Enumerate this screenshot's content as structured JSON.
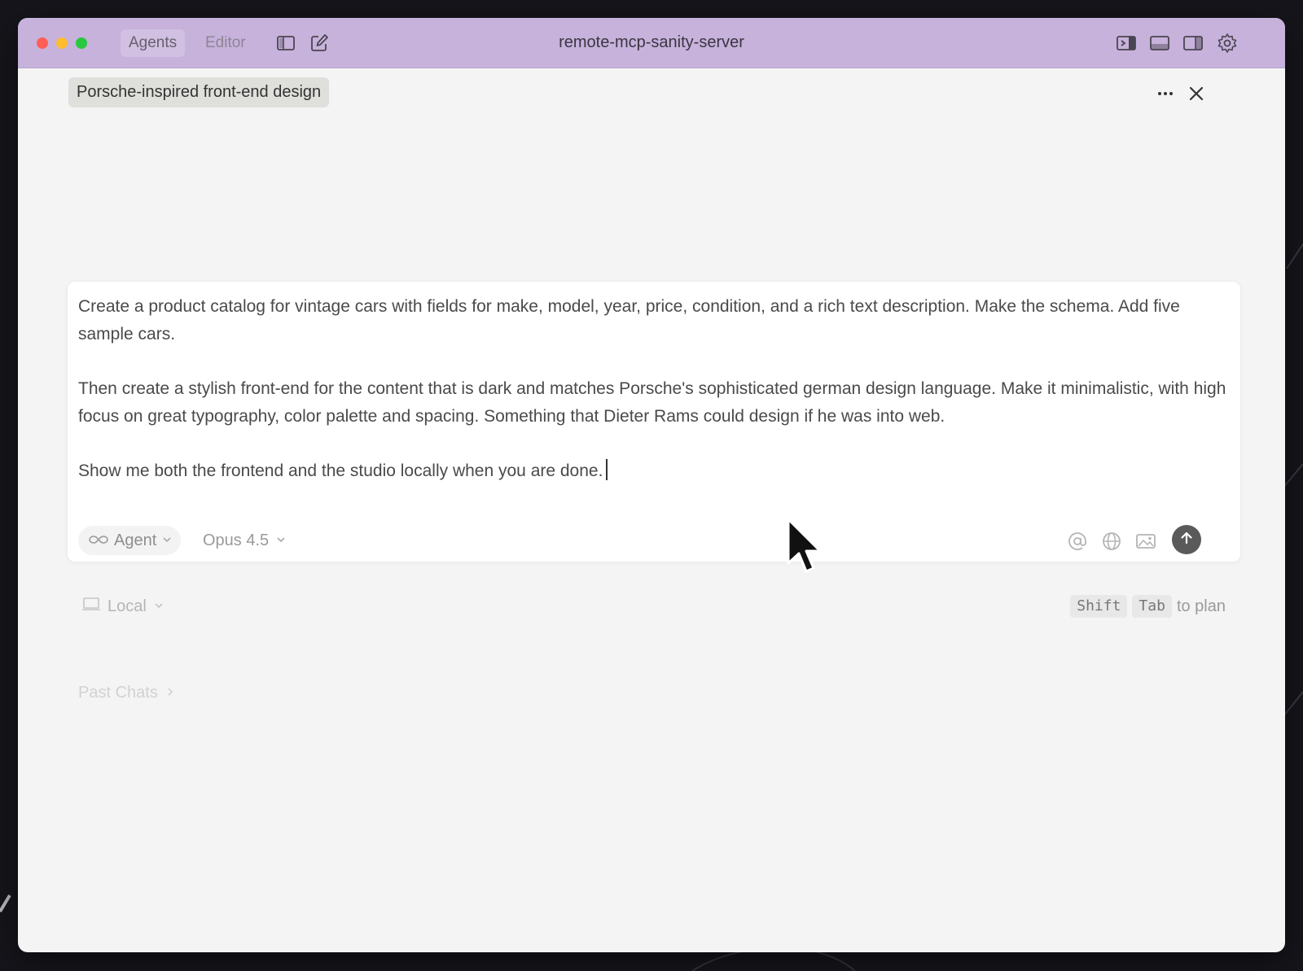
{
  "titlebar": {
    "tabs": [
      {
        "label": "Agents",
        "active": true
      },
      {
        "label": "Editor",
        "active": false
      }
    ],
    "title": "remote-mcp-sanity-server",
    "left_icons": [
      "sidebar-toggle-icon",
      "new-chat-icon"
    ],
    "right_icons": [
      "panel-left-icon",
      "panel-bottom-icon",
      "panel-right-icon",
      "gear-icon"
    ]
  },
  "chat": {
    "title": "Porsche-inspired front-end design",
    "menu_icon": "more-icon",
    "close_icon": "close-icon"
  },
  "composer": {
    "paragraphs": [
      "Create a product catalog for vintage cars with fields for make, model, year, price, condition, and a rich text description. Make the schema. Add five sample cars.",
      "Then create a stylish front-end for the content that is dark and matches Porsche's sophisticated german design language. Make it minimalistic, with high focus on great typography, color palette and spacing. Something that Dieter Rams could design if he was into web.",
      "Show me both the frontend and the studio locally when you are done."
    ],
    "mode_label": "Agent",
    "model_label": "Opus 4.5",
    "action_icons": [
      "at-icon",
      "globe-icon",
      "image-icon"
    ],
    "send_icon": "arrow-up-icon"
  },
  "footer": {
    "env_label": "Local",
    "hint_keys": [
      "Shift",
      "Tab"
    ],
    "hint_text": "to plan",
    "past_chats_label": "Past Chats"
  },
  "colors": {
    "titlebar": "#c7b2db",
    "background": "#f4f4f5",
    "chip": "#dfe0db",
    "send_button": "#5a5a5a"
  }
}
